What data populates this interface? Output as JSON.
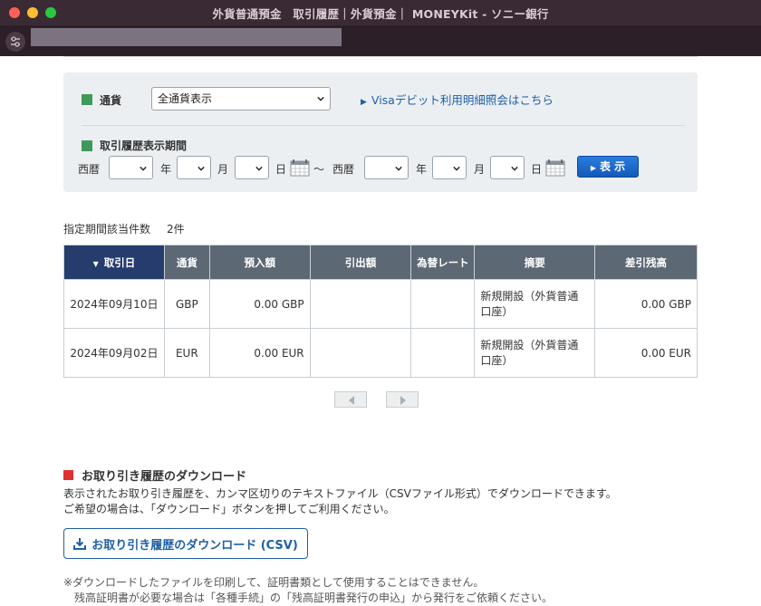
{
  "window": {
    "title": "外貨普通預金　取引履歴｜外貨預金｜ MONEYKit - ソニー銀行"
  },
  "filter": {
    "currency_label": "通貨",
    "currency_value": "全通貨表示",
    "visa_link": "Visaデビット利用明細照会はこちら",
    "period_label": "取引履歴表示期間",
    "era": "西暦",
    "year": "年",
    "month": "月",
    "day": "日",
    "tilde": "〜",
    "show_button": "表 示"
  },
  "count": {
    "label": "指定期間該当件数",
    "value": "2件"
  },
  "table": {
    "headers": [
      "取引日",
      "通貨",
      "預入額",
      "引出額",
      "為替レート",
      "摘要",
      "差引残高"
    ],
    "rows": [
      {
        "date": "2024年09月10日",
        "currency": "GBP",
        "deposit": "0.00 GBP",
        "withdrawal": "",
        "rate": "",
        "memo": "新規開設（外貨普通口座）",
        "balance": "0.00 GBP"
      },
      {
        "date": "2024年09月02日",
        "currency": "EUR",
        "deposit": "0.00 EUR",
        "withdrawal": "",
        "rate": "",
        "memo": "新規開設（外貨普通口座）",
        "balance": "0.00 EUR"
      }
    ]
  },
  "download": {
    "heading": "お取り引き履歴のダウンロード",
    "line1": "表示されたお取り引き履歴を、カンマ区切りのテキストファイル（CSVファイル形式）でダウンロードできます。",
    "line2": "ご希望の場合は、「ダウンロード」ボタンを押してご利用ください。",
    "button": "お取り引き履歴のダウンロード (CSV)",
    "note1": "※ダウンロードしたファイルを印刷して、証明書類として使用することはできません。",
    "note2": "　残高証明書が必要な場合は「各種手続」の「残高証明書発行の申込」から発行をご依頼ください。"
  },
  "colors": {
    "accent": "#1f5fa8",
    "header_bg": "#5d6875",
    "sorted_header_bg": "#253c6d",
    "green": "#3f9a5a",
    "red": "#e03030"
  }
}
